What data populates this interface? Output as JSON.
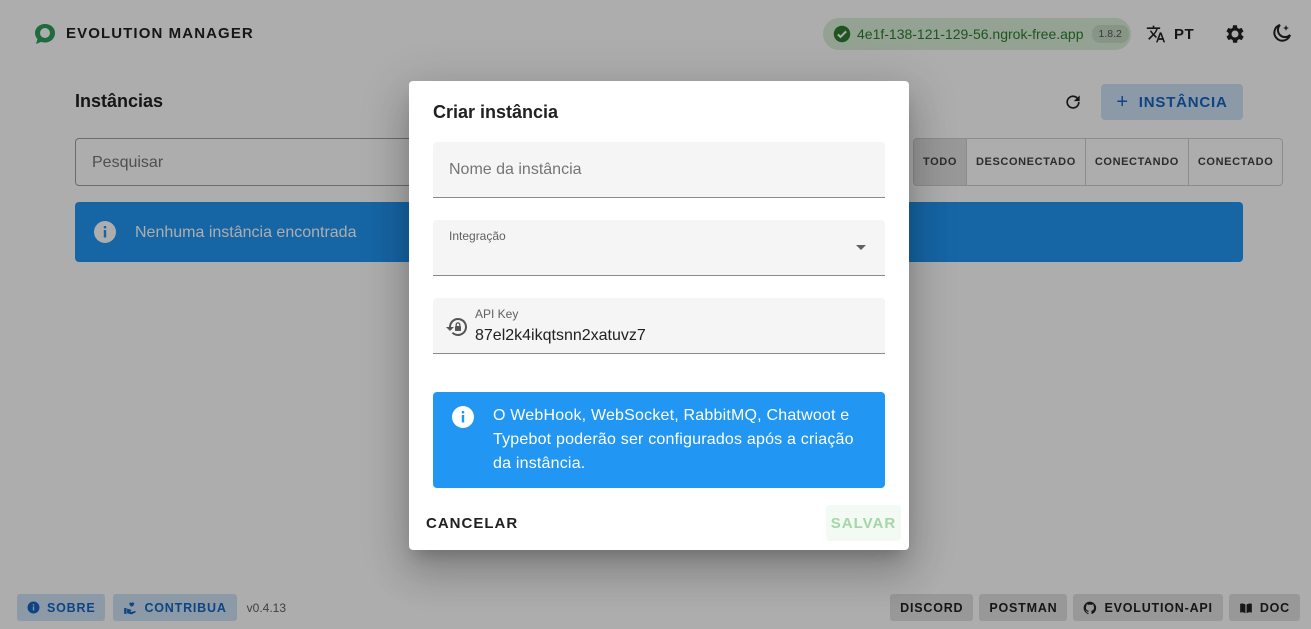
{
  "app": {
    "brand": "EVOLUTION MANAGER",
    "server_url": "4e1f-138-121-129-56.ngrok-free.app",
    "server_version": "1.8.2",
    "language": "PT",
    "icons": [
      "logo-icon",
      "check-circle-icon",
      "translate-icon",
      "gear-icon",
      "dark-mode-icon"
    ]
  },
  "page": {
    "title": "Instâncias",
    "add_button": "INSTÂNCIA",
    "search_placeholder": "Pesquisar",
    "filters": [
      "TODO",
      "DESCONECTADO",
      "CONECTANDO",
      "CONECTADO"
    ],
    "empty_message": "Nenhuma instância encontrada"
  },
  "footer": {
    "about": "SOBRE",
    "contribute": "CONTRIBUA",
    "version": "v0.4.13",
    "links": [
      "DISCORD",
      "POSTMAN",
      "EVOLUTION-API",
      "DOC"
    ]
  },
  "dialog": {
    "title": "Criar instância",
    "name_placeholder": "Nome da instância",
    "integration_label": "Integração",
    "integration_value": "",
    "api_key_label": "API Key",
    "api_key_value": "87el2k4ikqtsnn2xatuvz7",
    "info_text": "O WebHook, WebSocket, RabbitMQ, Chatwoot e Typebot poderão ser configurados após a criação da instância.",
    "cancel": "CANCELAR",
    "save": "SALVAR"
  },
  "colors": {
    "accent": "#2196f3",
    "success": "#2e7d32",
    "primary_text": "#1565c0"
  }
}
